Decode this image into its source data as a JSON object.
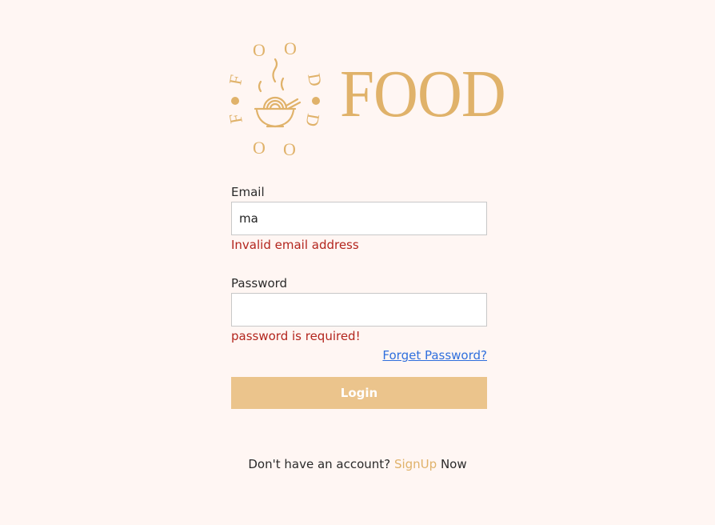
{
  "logo": {
    "wordmark": "FOOD",
    "ring_letters": [
      "O",
      "O",
      "D",
      "D",
      "O",
      "O",
      "F",
      "F"
    ],
    "brand_color": "#e0b26a",
    "icon": "noodle-bowl-icon"
  },
  "form": {
    "email_label": "Email",
    "email_value": "ma",
    "email_error": "Invalid email address",
    "password_label": "Password",
    "password_value": "",
    "password_error": "password is required!",
    "forgot_label": "Forget Password?",
    "login_label": "Login"
  },
  "signup": {
    "prefix": "Don't have an account?",
    "link_label": "SignUp",
    "suffix": "Now"
  },
  "colors": {
    "background": "#fff6f3",
    "accent": "#e0b26a",
    "button": "#ebc48c",
    "error": "#b3261e",
    "link": "#2f6fdd"
  }
}
